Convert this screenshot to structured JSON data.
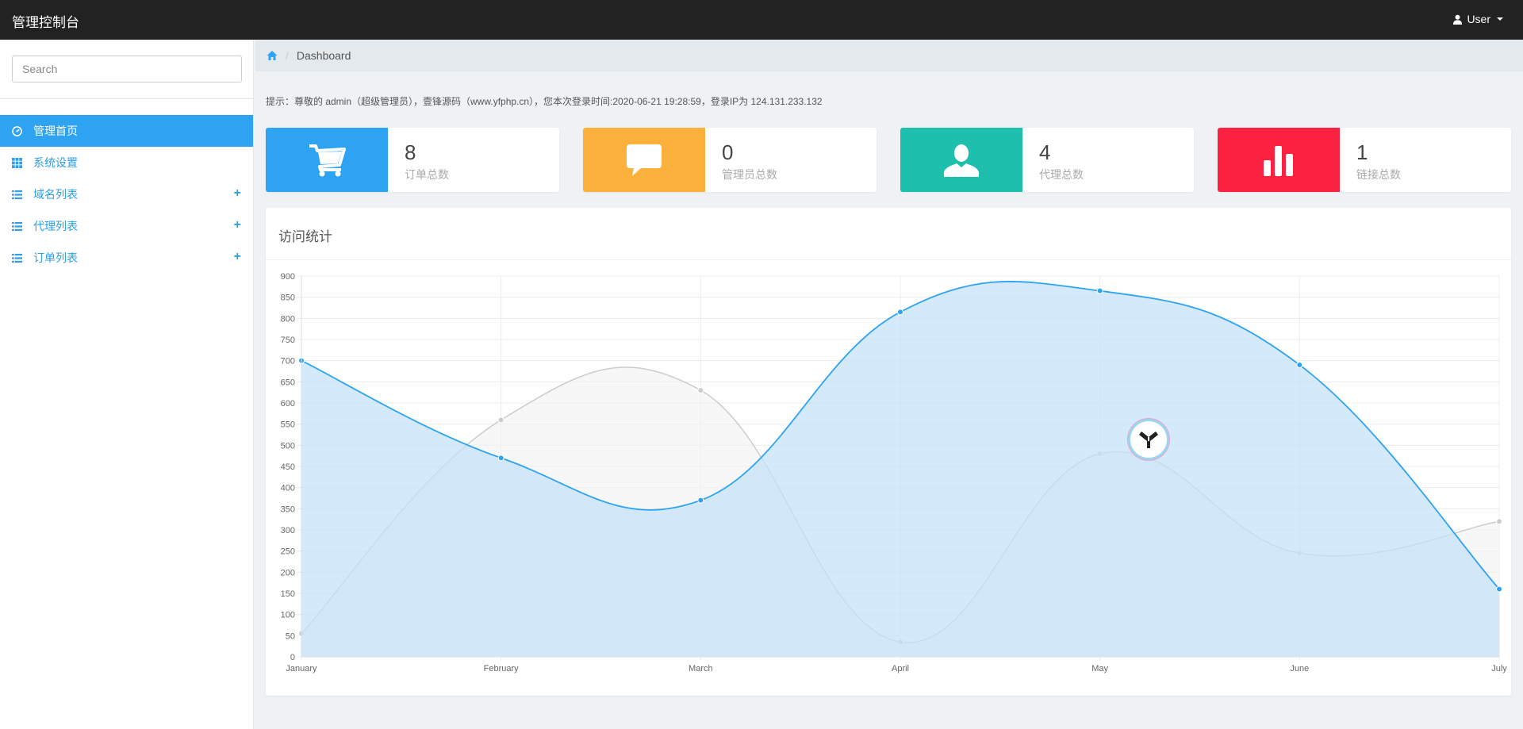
{
  "navbar": {
    "brand": "管理控制台",
    "user_label": "User"
  },
  "sidebar": {
    "search_placeholder": "Search",
    "items": [
      {
        "label": "管理首页",
        "icon": "dashboard-icon",
        "active": true,
        "expandable": false
      },
      {
        "label": "系统设置",
        "icon": "grid-icon",
        "active": false,
        "expandable": false
      },
      {
        "label": "域名列表",
        "icon": "list-icon",
        "active": false,
        "expandable": true
      },
      {
        "label": "代理列表",
        "icon": "list-icon",
        "active": false,
        "expandable": true
      },
      {
        "label": "订单列表",
        "icon": "list-icon",
        "active": false,
        "expandable": true
      }
    ],
    "expand_symbol": "+"
  },
  "breadcrumb": {
    "home_icon": "home-icon",
    "separator": "/",
    "current": "Dashboard"
  },
  "notice": "提示：尊敬的 admin（超级管理员），壹锋源码（www.yfphp.cn），您本次登录时间:2020-06-21 19:28:59，登录IP为 124.131.233.132",
  "stats": [
    {
      "value": "8",
      "label": "订单总数",
      "color": "#2ea3f2",
      "icon": "cart-icon"
    },
    {
      "value": "0",
      "label": "管理员总数",
      "color": "#fbb13c",
      "icon": "comment-icon"
    },
    {
      "value": "4",
      "label": "代理总数",
      "color": "#1fbfad",
      "icon": "user-icon"
    },
    {
      "value": "1",
      "label": "链接总数",
      "color": "#fb2141",
      "icon": "bar-chart-icon"
    }
  ],
  "panel": {
    "title": "访问统计"
  },
  "chart_data": {
    "type": "area",
    "categories": [
      "January",
      "February",
      "March",
      "April",
      "May",
      "June",
      "July"
    ],
    "ylim": [
      0,
      900
    ],
    "ytick_step": 50,
    "grid": true,
    "series": [
      {
        "values": [
          55,
          560,
          630,
          35,
          480,
          245,
          320
        ],
        "color": "#cccccc",
        "fill": "#f2f2f2"
      },
      {
        "values": [
          700,
          470,
          370,
          815,
          865,
          690,
          160
        ],
        "color": "#2ea3f2",
        "fill": "#c5e3f8"
      }
    ]
  },
  "colors": {
    "accent": "#2ea3f2",
    "navbar": "#222222",
    "background": "#eef2f5"
  }
}
